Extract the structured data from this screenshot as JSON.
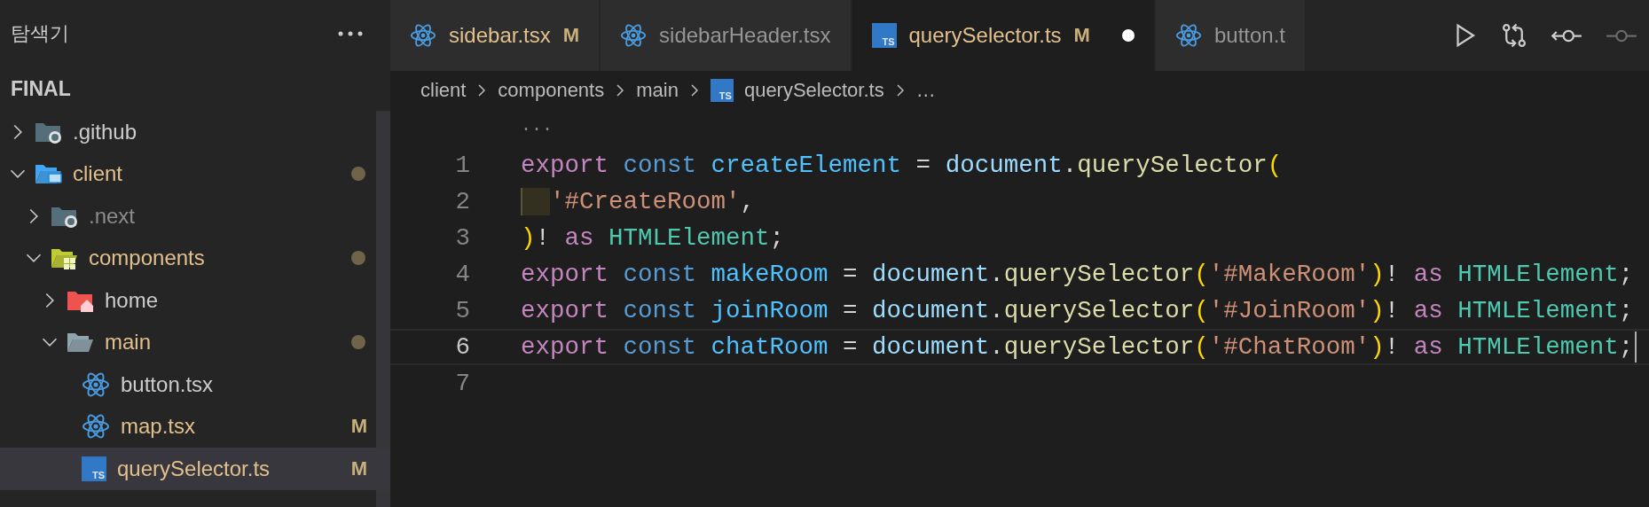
{
  "sidebar": {
    "title": "탐색기",
    "root": {
      "label": "FINAL",
      "expanded": true
    },
    "tree": [
      {
        "label": ".github",
        "kind": "github-folder",
        "expanded": false,
        "selected": false,
        "modified": false,
        "ignored": false
      },
      {
        "label": "client",
        "kind": "client-folder",
        "expanded": true,
        "selected": false,
        "modified": true,
        "ignored": false,
        "children": [
          {
            "label": ".next",
            "kind": "next-folder",
            "expanded": false,
            "selected": false,
            "modified": false,
            "ignored": true
          },
          {
            "label": "components",
            "kind": "components-folder",
            "expanded": true,
            "selected": false,
            "modified": true,
            "ignored": false,
            "children": [
              {
                "label": "home",
                "kind": "home-folder",
                "expanded": false,
                "selected": false,
                "modified": false,
                "ignored": false
              },
              {
                "label": "main",
                "kind": "folder",
                "expanded": true,
                "selected": false,
                "modified": true,
                "ignored": false,
                "children": [
                  {
                    "label": "button.tsx",
                    "kind": "react",
                    "selected": false,
                    "modified": false,
                    "ignored": false
                  },
                  {
                    "label": "map.tsx",
                    "kind": "react",
                    "selected": false,
                    "modified": true,
                    "ignored": false,
                    "git_status": "M"
                  },
                  {
                    "label": "querySelector.ts",
                    "kind": "ts",
                    "icon_text": "TS",
                    "selected": true,
                    "modified": true,
                    "ignored": false,
                    "git_status": "M"
                  }
                ]
              }
            ]
          }
        ]
      }
    ]
  },
  "tabs": [
    {
      "label": "sidebar.tsx",
      "kind": "react",
      "selected": false,
      "modified": true,
      "unsaved": false,
      "git_status": "M"
    },
    {
      "label": "sidebarHeader.tsx",
      "kind": "react",
      "selected": false,
      "modified": false,
      "unsaved": false
    },
    {
      "label": "querySelector.ts",
      "kind": "ts",
      "icon_text": "TS",
      "selected": true,
      "modified": true,
      "unsaved": true,
      "git_status": "M"
    },
    {
      "label": "button.t",
      "kind": "react",
      "selected": false,
      "modified": false,
      "unsaved": false
    }
  ],
  "breadcrumb": [
    {
      "label": "client",
      "kind": "folder"
    },
    {
      "label": "components",
      "kind": "folder"
    },
    {
      "label": "main",
      "kind": "folder"
    },
    {
      "label": "querySelector.ts",
      "kind": "ts",
      "icon_text": "TS"
    },
    {
      "label": "…",
      "kind": "more"
    }
  ],
  "editor": {
    "fold_marker": "···",
    "lines": [
      {
        "number": "1",
        "current": false,
        "indent_highlight": false,
        "tokens": [
          {
            "kind": "keyword",
            "text": "export "
          },
          {
            "kind": "storage",
            "text": "const "
          },
          {
            "kind": "constant",
            "text": "createElement"
          },
          {
            "kind": "plain",
            "text": " = "
          },
          {
            "kind": "variable",
            "text": "document"
          },
          {
            "kind": "plain",
            "text": "."
          },
          {
            "kind": "function",
            "text": "querySelector"
          },
          {
            "kind": "bracket",
            "text": "("
          }
        ]
      },
      {
        "number": "2",
        "current": false,
        "indent_highlight": true,
        "tokens": [
          {
            "kind": "string",
            "text": "'#CreateRoom'"
          },
          {
            "kind": "plain",
            "text": ","
          }
        ]
      },
      {
        "number": "3",
        "current": false,
        "indent_highlight": false,
        "tokens": [
          {
            "kind": "bracket",
            "text": ")"
          },
          {
            "kind": "plain",
            "text": "! "
          },
          {
            "kind": "keyword",
            "text": "as "
          },
          {
            "kind": "type",
            "text": "HTMLElement"
          },
          {
            "kind": "plain",
            "text": ";"
          }
        ]
      },
      {
        "number": "4",
        "current": false,
        "indent_highlight": false,
        "tokens": [
          {
            "kind": "keyword",
            "text": "export "
          },
          {
            "kind": "storage",
            "text": "const "
          },
          {
            "kind": "constant",
            "text": "makeRoom"
          },
          {
            "kind": "plain",
            "text": " = "
          },
          {
            "kind": "variable",
            "text": "document"
          },
          {
            "kind": "plain",
            "text": "."
          },
          {
            "kind": "function",
            "text": "querySelector"
          },
          {
            "kind": "bracket",
            "text": "("
          },
          {
            "kind": "string",
            "text": "'#MakeRoom'"
          },
          {
            "kind": "bracket",
            "text": ")"
          },
          {
            "kind": "plain",
            "text": "! "
          },
          {
            "kind": "keyword",
            "text": "as "
          },
          {
            "kind": "type",
            "text": "HTMLElement"
          },
          {
            "kind": "plain",
            "text": ";"
          }
        ]
      },
      {
        "number": "5",
        "current": false,
        "indent_highlight": false,
        "tokens": [
          {
            "kind": "keyword",
            "text": "export "
          },
          {
            "kind": "storage",
            "text": "const "
          },
          {
            "kind": "constant",
            "text": "joinRoom"
          },
          {
            "kind": "plain",
            "text": " = "
          },
          {
            "kind": "variable",
            "text": "document"
          },
          {
            "kind": "plain",
            "text": "."
          },
          {
            "kind": "function",
            "text": "querySelector"
          },
          {
            "kind": "bracket",
            "text": "("
          },
          {
            "kind": "string",
            "text": "'#JoinRoom'"
          },
          {
            "kind": "bracket",
            "text": ")"
          },
          {
            "kind": "plain",
            "text": "! "
          },
          {
            "kind": "keyword",
            "text": "as "
          },
          {
            "kind": "type",
            "text": "HTMLElement"
          },
          {
            "kind": "plain",
            "text": ";"
          }
        ]
      },
      {
        "number": "6",
        "current": true,
        "indent_highlight": false,
        "tokens": [
          {
            "kind": "keyword",
            "text": "export "
          },
          {
            "kind": "storage",
            "text": "const "
          },
          {
            "kind": "constant",
            "text": "chatRoom"
          },
          {
            "kind": "plain",
            "text": " = "
          },
          {
            "kind": "variable",
            "text": "document"
          },
          {
            "kind": "plain",
            "text": "."
          },
          {
            "kind": "function",
            "text": "querySelector"
          },
          {
            "kind": "bracket",
            "text": "("
          },
          {
            "kind": "string",
            "text": "'#ChatRoom'"
          },
          {
            "kind": "bracket",
            "text": ")"
          },
          {
            "kind": "plain",
            "text": "! "
          },
          {
            "kind": "keyword",
            "text": "as "
          },
          {
            "kind": "type",
            "text": "HTMLElement"
          },
          {
            "kind": "plain",
            "text": ";"
          }
        ]
      },
      {
        "number": "7",
        "current": false,
        "indent_highlight": false
      }
    ]
  }
}
